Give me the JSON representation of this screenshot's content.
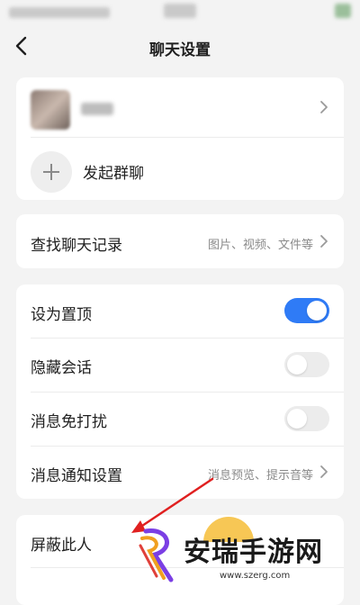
{
  "header": {
    "title": "聊天设置"
  },
  "contact_card": {
    "create_group_label": "发起群聊"
  },
  "search_card": {
    "label": "查找聊天记录",
    "hint": "图片、视频、文件等"
  },
  "settings_card": {
    "items": [
      {
        "label": "设为置顶",
        "toggle": true
      },
      {
        "label": "隐藏会话",
        "toggle": false
      },
      {
        "label": "消息免打扰",
        "toggle": false
      },
      {
        "label": "消息通知设置",
        "hint": "消息预览、提示音等"
      }
    ]
  },
  "block_card": {
    "label": "屏蔽此人"
  },
  "watermark": {
    "text": "安瑞手游网",
    "url": "www.szerg.com"
  },
  "colors": {
    "accent": "#2f7bf6",
    "annotation_arrow": "#e02020"
  }
}
